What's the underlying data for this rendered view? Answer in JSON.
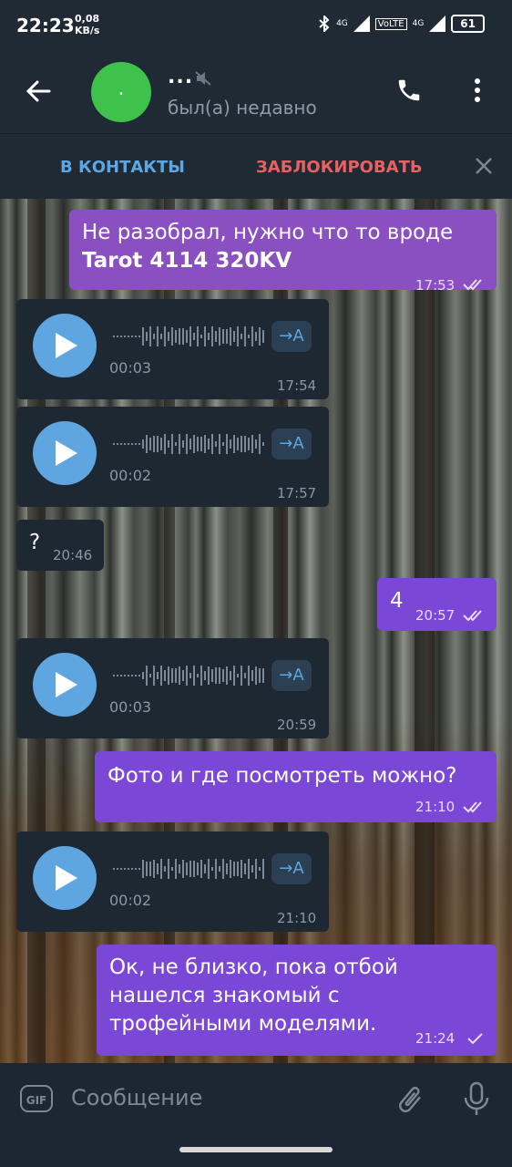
{
  "status_bar": {
    "time": "22:23",
    "speed_value": "0,08",
    "speed_unit": "KB/s",
    "network1": "4G",
    "volte": "VoLTE",
    "network2": "4G",
    "battery": "61"
  },
  "header": {
    "avatar_letter": ".",
    "name": "...",
    "status": "был(а) недавно"
  },
  "action_bar": {
    "add_contact": "В КОНТАКТЫ",
    "block": "ЗАБЛОКИРОВАТЬ"
  },
  "messages": [
    {
      "type": "text",
      "direction": "out",
      "text_line1": "Не разобрал, нужно что то вроде",
      "text_line2": "Tarot 4114 320KV",
      "time": "17:53",
      "read": true
    },
    {
      "type": "voice",
      "direction": "in",
      "duration": "00:03",
      "time": "17:54",
      "transcribe": "→A"
    },
    {
      "type": "voice",
      "direction": "in",
      "duration": "00:02",
      "time": "17:57",
      "transcribe": "→A"
    },
    {
      "type": "text",
      "direction": "in",
      "text": "?",
      "time": "20:46"
    },
    {
      "type": "text",
      "direction": "out",
      "text": "4",
      "time": "20:57",
      "read": true
    },
    {
      "type": "voice",
      "direction": "in",
      "duration": "00:03",
      "time": "20:59",
      "transcribe": "→A"
    },
    {
      "type": "text",
      "direction": "out",
      "text": "Фото и где посмотреть можно?",
      "time": "21:10",
      "read": true
    },
    {
      "type": "voice",
      "direction": "in",
      "duration": "00:02",
      "time": "21:10",
      "transcribe": "→A"
    },
    {
      "type": "text",
      "direction": "out",
      "text_line1": "Ок, не близко, пока отбой",
      "text_line2": "нашелся знакомый с",
      "text_line3": "трофейными моделями.",
      "time": "21:24",
      "read": false
    }
  ],
  "input": {
    "gif_label": "GIF",
    "placeholder": "Сообщение"
  },
  "colors": {
    "outgoing_bubble": "#8a4fc0",
    "outgoing_bubble_alt": "#7b47d6",
    "incoming_bubble": "#1e2833",
    "accent_blue": "#5ea6e3",
    "block_red": "#e66262",
    "avatar_green": "#3fc24c"
  }
}
